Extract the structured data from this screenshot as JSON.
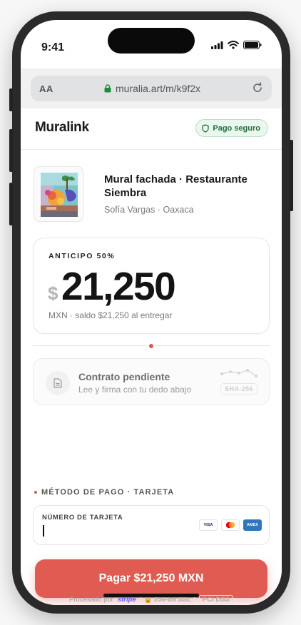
{
  "status": {
    "time": "9:41"
  },
  "browser": {
    "aa_label": "AA",
    "url": "muralia.art/m/k9f2x"
  },
  "header": {
    "brand": "Muralink",
    "secure_badge": "Pago seguro"
  },
  "project": {
    "title": "Mural fachada · Restaurante Siembra",
    "subtitle": "Sofía Vargas · Oaxaca"
  },
  "payment": {
    "deposit_label": "ANTICIPO 50%",
    "currency_symbol": "$",
    "amount": "21,250",
    "amount_sub": "MXN · saldo $21,250 al entregar"
  },
  "contract": {
    "title": "Contrato pendiente",
    "subtitle": "Lee y firma con tu dedo abajo",
    "hash_badge": "SHA-256"
  },
  "method": {
    "label": "MÉTODO DE PAGO · TARJETA",
    "card_label": "NÚMERO DE TARJETA",
    "card_value": "",
    "brands": [
      "VISA",
      "",
      "AMEX"
    ]
  },
  "cta": {
    "pay_label": "Pagar $21,250 MXN"
  },
  "footer": {
    "processed_by": "Procesado por",
    "processor": "stripe",
    "ssl": "🔒 256-bit SSL",
    "pci": "PCI DSS"
  },
  "colors": {
    "accent": "#e05c53",
    "secure_green": "#246c3a"
  }
}
